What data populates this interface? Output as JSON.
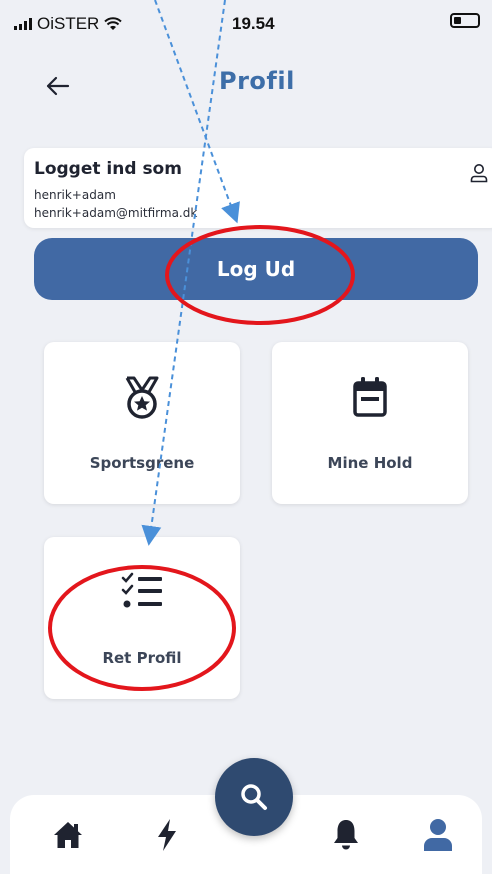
{
  "status_bar": {
    "carrier": "OiSTER",
    "time": "19.54"
  },
  "header": {
    "title": "Profil",
    "back_icon": "arrow-left-icon"
  },
  "profile_card": {
    "heading": "Logget ind som",
    "username": "henrik+adam",
    "email": "henrik+adam@mitfirma.dk",
    "icon": "user-outline-icon"
  },
  "logout_button": {
    "label": "Log Ud"
  },
  "tiles": [
    {
      "label": "Sportsgrene",
      "icon": "medal-icon"
    },
    {
      "label": "Mine Hold",
      "icon": "calendar-icon"
    },
    {
      "label": "Ret Profil",
      "icon": "checklist-icon"
    }
  ],
  "bottom_nav": {
    "items": [
      "home-icon",
      "bolt-icon",
      "search-icon",
      "bell-icon",
      "user-icon"
    ],
    "active": "user-icon"
  },
  "colors": {
    "accent": "#4169a4",
    "title": "#3d6ea8",
    "fab": "#2f4a70",
    "annotation_red": "#e3161c",
    "annotation_arrow": "#4a90d9"
  }
}
